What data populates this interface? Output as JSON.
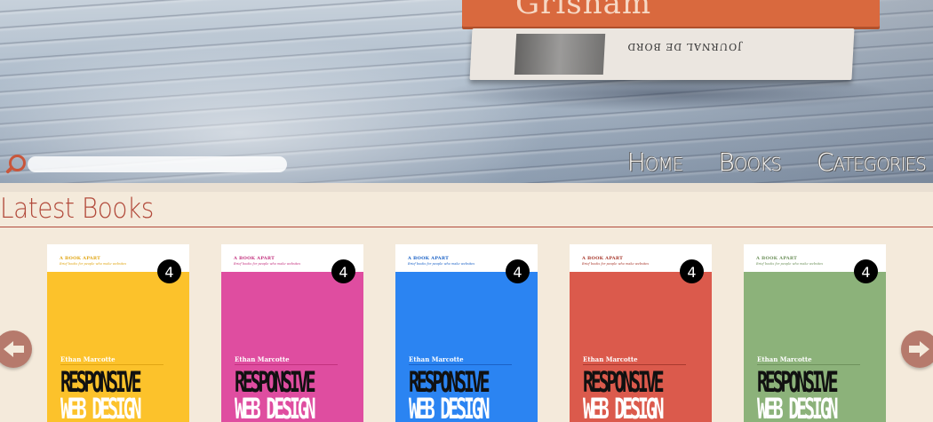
{
  "hero": {
    "book_top_text": "Grisham",
    "book_bottom_text": "JOURNAL DE BORD"
  },
  "search": {
    "placeholder": "",
    "value": ""
  },
  "nav": {
    "items": [
      {
        "label": "Home"
      },
      {
        "label": "Books"
      },
      {
        "label": "Categories"
      }
    ]
  },
  "section": {
    "title": "Latest Books"
  },
  "books": [
    {
      "color": "#fcc22b",
      "accent": "#e1a614",
      "publisher": "A BOOK APART",
      "tagline": "Brief books for people who make websites",
      "number": "4",
      "author": "Ethan Marcotte",
      "title_line1": "RESPONSIVE",
      "title_line2": "WEB DESIGN"
    },
    {
      "color": "#df4da0",
      "accent": "#c3327f",
      "publisher": "A BOOK APART",
      "tagline": "Brief books for people who make websites",
      "number": "4",
      "author": "Ethan Marcotte",
      "title_line1": "RESPONSIVE",
      "title_line2": "WEB DESIGN"
    },
    {
      "color": "#2b84f2",
      "accent": "#1b62c6",
      "publisher": "A BOOK APART",
      "tagline": "Brief books for people who make websites",
      "number": "4",
      "author": "Ethan Marcotte",
      "title_line1": "RESPONSIVE",
      "title_line2": "WEB DESIGN"
    },
    {
      "color": "#db5a4c",
      "accent": "#a83a2e",
      "publisher": "A BOOK APART",
      "tagline": "Brief books for people who make websites",
      "number": "4",
      "author": "Ethan Marcotte",
      "title_line1": "RESPONSIVE",
      "title_line2": "WEB DESIGN"
    },
    {
      "color": "#8cb27a",
      "accent": "#6f925d",
      "publisher": "A BOOK APART",
      "tagline": "Brief books for people who make websites",
      "number": "4",
      "author": "Ethan Marcotte",
      "title_line1": "RESPONSIVE",
      "title_line2": "WEB DESIGN"
    }
  ],
  "carousel": {
    "prev_icon": "arrow-left-icon",
    "next_icon": "arrow-right-icon"
  },
  "colors": {
    "accent": "#b24a3b",
    "background": "#f4eadb",
    "arrow": "#b67a6c"
  }
}
